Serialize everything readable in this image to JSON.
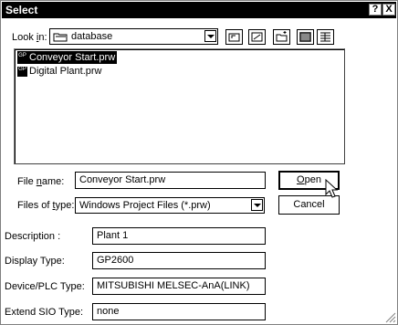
{
  "window": {
    "title": "Select",
    "help_label": "?",
    "close_label": "X"
  },
  "lookin": {
    "label_pre": "Look ",
    "label_mn": "i",
    "label_post": "n:",
    "value": "database"
  },
  "files": [
    {
      "name": "Conveyor Start.prw",
      "selected": true
    },
    {
      "name": "Digital Plant.prw",
      "selected": false
    }
  ],
  "filename": {
    "label_pre": "File ",
    "label_mn": "n",
    "label_post": "ame:",
    "value": "Conveyor Start.prw"
  },
  "filetype": {
    "label_pre": "Files of ",
    "label_mn": "t",
    "label_post": "ype:",
    "value": "Windows Project Files (*.prw)"
  },
  "buttons": {
    "open_mn": "O",
    "open_rest": "pen",
    "cancel": "Cancel"
  },
  "info": {
    "description": {
      "label": "Description :",
      "value": "Plant 1"
    },
    "display_type": {
      "label": "Display Type:",
      "value": "GP2600"
    },
    "device": {
      "label": "Device/PLC Type:",
      "value": "MITSUBISHI MELSEC-AnA(LINK)"
    },
    "extend_sio": {
      "label": "Extend SIO Type:",
      "value": "none"
    }
  }
}
